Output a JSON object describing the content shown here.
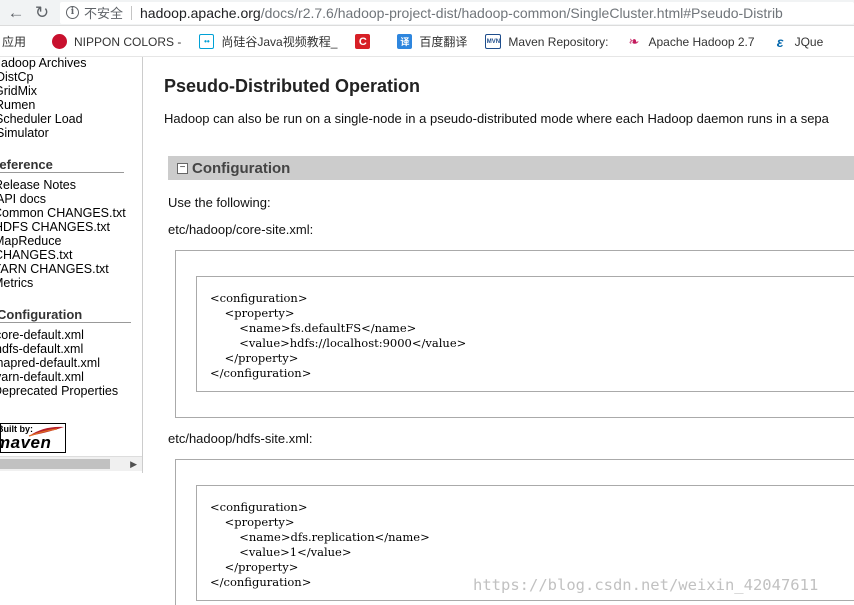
{
  "browser": {
    "insecure_label": "不安全",
    "url_host": "hadoop.apache.org",
    "url_path": "/docs/r2.7.6/hadoop-project-dist/hadoop-common/SingleCluster.html#Pseudo-Distrib",
    "bookmarks": [
      {
        "label": "应用",
        "icon": "apps-grid-icon"
      },
      {
        "label": "NIPPON COLORS -",
        "icon": "nippon-red-circle-icon"
      },
      {
        "label": "尚硅谷Java视频教程_",
        "icon": "bilibili-tv-icon"
      },
      {
        "label": "",
        "icon": "red-c-icon"
      },
      {
        "label": "百度翻译",
        "icon": "baidu-translate-icon"
      },
      {
        "label": "Maven Repository:",
        "icon": "mvn-icon"
      },
      {
        "label": "Apache Hadoop 2.7",
        "icon": "feather-icon"
      },
      {
        "label": "JQue",
        "icon": "jquery-e-icon"
      }
    ]
  },
  "sidebar": {
    "items_top": [
      "Hadoop Archives",
      "DistCp",
      "GridMix",
      "Rumen",
      "Scheduler Load",
      "Simulator"
    ],
    "reference_heading": "Reference",
    "reference_items": [
      "Release Notes",
      "API docs",
      "Common CHANGES.txt",
      "HDFS CHANGES.txt",
      "MapReduce",
      "CHANGES.txt",
      "YARN CHANGES.txt",
      "Metrics"
    ],
    "configuration_heading": "Configuration",
    "configuration_items": [
      "core-default.xml",
      "hdfs-default.xml",
      "mapred-default.xml",
      "yarn-default.xml",
      "Deprecated Properties"
    ],
    "maven_built_by": "Built by:",
    "maven_name": "maven"
  },
  "main": {
    "title": "Pseudo-Distributed Operation",
    "intro": "Hadoop can also be run on a single-node in a pseudo-distributed mode where each Hadoop daemon runs in a sepa",
    "section_title": "Configuration",
    "use_following": "Use the following:",
    "core_site_label": "etc/hadoop/core-site.xml:",
    "core_site_code": [
      "<configuration>",
      "    <property>",
      "        <name>fs.defaultFS</name>",
      "        <value>hdfs://localhost:9000</value>",
      "    </property>",
      "</configuration>"
    ],
    "hdfs_site_label": "etc/hadoop/hdfs-site.xml:",
    "hdfs_site_code": [
      "<configuration>",
      "    <property>",
      "        <name>dfs.replication</name>",
      "        <value>1</value>",
      "    </property>",
      "</configuration>"
    ]
  },
  "watermark": "https://blog.csdn.net/weixin_42047611"
}
